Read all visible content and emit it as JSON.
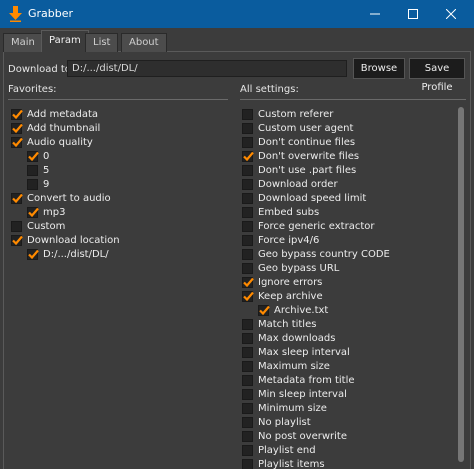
{
  "window": {
    "title": "Grabber",
    "accent": "#0a5c9e",
    "check_color": "#ff8a00"
  },
  "tabs": [
    {
      "label": "Main",
      "active": false
    },
    {
      "label": "Param",
      "active": true
    },
    {
      "label": "List",
      "active": false
    },
    {
      "label": "About",
      "active": false
    }
  ],
  "download": {
    "label": "Download to:",
    "path": "D:/.../dist/DL/",
    "browse_label": "Browse",
    "profile_label": "Save Profile"
  },
  "favorites": {
    "label": "Favorites:",
    "items": [
      {
        "label": "Add metadata",
        "checked": true,
        "level": 0
      },
      {
        "label": "Add thumbnail",
        "checked": true,
        "level": 0
      },
      {
        "label": "Audio quality",
        "checked": true,
        "level": 0
      },
      {
        "label": "0",
        "checked": true,
        "level": 1
      },
      {
        "label": "5",
        "checked": false,
        "level": 1
      },
      {
        "label": "9",
        "checked": false,
        "level": 1
      },
      {
        "label": "Convert to audio",
        "checked": true,
        "level": 0
      },
      {
        "label": "mp3",
        "checked": true,
        "level": 1
      },
      {
        "label": "Custom",
        "checked": false,
        "level": 0
      },
      {
        "label": "Download location",
        "checked": true,
        "level": 0
      },
      {
        "label": "D:/.../dist/DL/",
        "checked": true,
        "level": 1
      }
    ]
  },
  "all_settings": {
    "label": "All settings:",
    "items": [
      {
        "label": "Custom referer",
        "checked": false,
        "level": 0
      },
      {
        "label": "Custom user agent",
        "checked": false,
        "level": 0
      },
      {
        "label": "Don't continue files",
        "checked": false,
        "level": 0
      },
      {
        "label": "Don't overwrite files",
        "checked": true,
        "level": 0
      },
      {
        "label": "Don't use .part files",
        "checked": false,
        "level": 0
      },
      {
        "label": "Download order",
        "checked": false,
        "level": 0
      },
      {
        "label": "Download speed limit",
        "checked": false,
        "level": 0
      },
      {
        "label": "Embed subs",
        "checked": false,
        "level": 0
      },
      {
        "label": "Force generic extractor",
        "checked": false,
        "level": 0
      },
      {
        "label": "Force ipv4/6",
        "checked": false,
        "level": 0
      },
      {
        "label": "Geo bypass country CODE",
        "checked": false,
        "level": 0
      },
      {
        "label": "Geo bypass URL",
        "checked": false,
        "level": 0
      },
      {
        "label": "Ignore errors",
        "checked": true,
        "level": 0
      },
      {
        "label": "Keep archive",
        "checked": true,
        "level": 0
      },
      {
        "label": "Archive.txt",
        "checked": true,
        "level": 1
      },
      {
        "label": "Match titles",
        "checked": false,
        "level": 0
      },
      {
        "label": "Max downloads",
        "checked": false,
        "level": 0
      },
      {
        "label": "Max sleep interval",
        "checked": false,
        "level": 0
      },
      {
        "label": "Maximum size",
        "checked": false,
        "level": 0
      },
      {
        "label": "Metadata from title",
        "checked": false,
        "level": 0
      },
      {
        "label": "Min sleep interval",
        "checked": false,
        "level": 0
      },
      {
        "label": "Minimum size",
        "checked": false,
        "level": 0
      },
      {
        "label": "No playlist",
        "checked": false,
        "level": 0
      },
      {
        "label": "No post overwrite",
        "checked": false,
        "level": 0
      },
      {
        "label": "Playlist end",
        "checked": false,
        "level": 0
      },
      {
        "label": "Playlist items",
        "checked": false,
        "level": 0
      }
    ]
  }
}
